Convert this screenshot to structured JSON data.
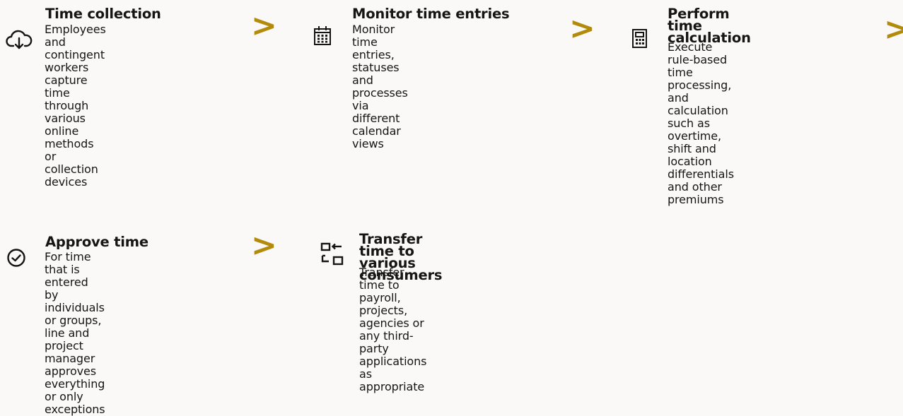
{
  "colors": {
    "background": "#fbf9f8",
    "text": "#161513",
    "arrow": "#b38b0c"
  },
  "arrow_glyph": ">",
  "steps": [
    {
      "icon": "cloud-download-icon",
      "title": "Time collection",
      "description": "Employees and\ncontingent workers\ncapture time through\nvarious online methods\nor collection devices"
    },
    {
      "icon": "calendar-icon",
      "title": "Monitor time entries",
      "description": "Monitor time entries,\nstatuses and processes via\ndifferent calendar views"
    },
    {
      "icon": "calculator-icon",
      "title": "Perform time\ncalculation",
      "description": "Execute rule-based time\nprocessing, and\ncalculation such as\novertime, shift and\nlocation differentials\nand other premiums"
    },
    {
      "icon": "checkmark-circle-icon",
      "title": "Approve time",
      "description": "For time that is entered\nby individuals or groups,\nline and project\nmanager approves\neverything or only\nexceptions"
    },
    {
      "icon": "transfer-icon",
      "title": "Transfer time to\nvarious consumers",
      "description": "Transfer time to payroll,\nprojects, agencies or\nany third-party\napplications as\nappropriate"
    }
  ]
}
